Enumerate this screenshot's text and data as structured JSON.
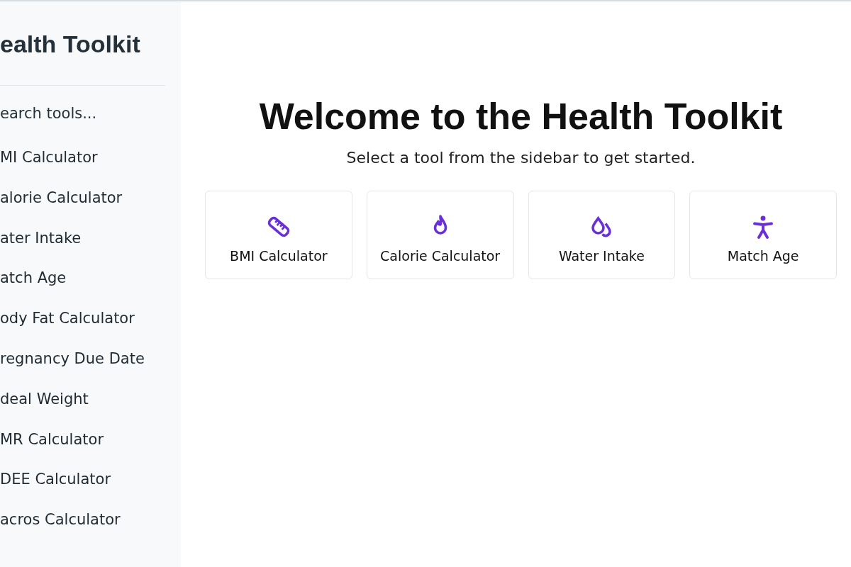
{
  "sidebar": {
    "title": "ealth Toolkit",
    "search": {
      "placeholder": "earch tools..."
    },
    "items": [
      {
        "label": "MI Calculator"
      },
      {
        "label": "alorie Calculator"
      },
      {
        "label": "ater Intake"
      },
      {
        "label": "atch Age"
      },
      {
        "label": "ody Fat Calculator"
      },
      {
        "label": "regnancy Due Date"
      },
      {
        "label": "deal Weight"
      },
      {
        "label": "MR Calculator"
      },
      {
        "label": "DEE Calculator"
      },
      {
        "label": "acros Calculator"
      }
    ]
  },
  "main": {
    "heading": "Welcome to the Health Toolkit",
    "subtitle": "Select a tool from the sidebar to get started.",
    "cards": [
      {
        "kind": "ruler",
        "label": "BMI Calculator"
      },
      {
        "kind": "flame",
        "label": "Calorie Calculator"
      },
      {
        "kind": "drops",
        "label": "Water Intake"
      },
      {
        "kind": "person",
        "label": "Match Age"
      }
    ]
  }
}
